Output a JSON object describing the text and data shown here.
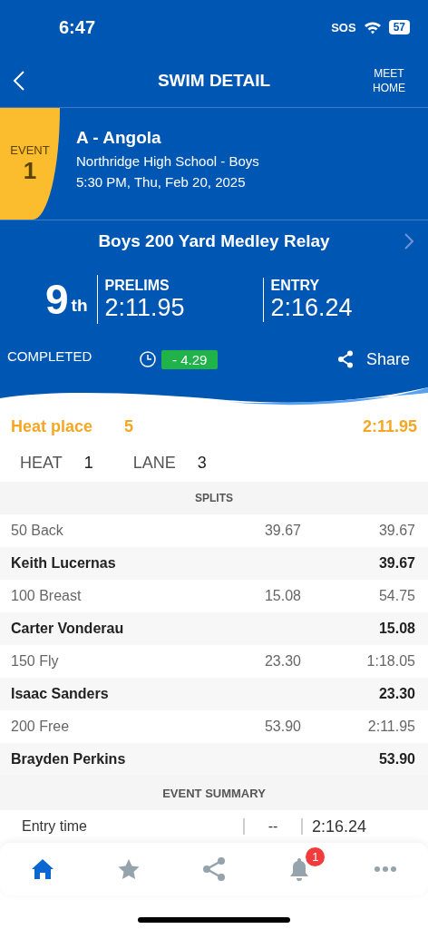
{
  "status_bar": {
    "time": "6:47",
    "sos": "SOS",
    "battery": "57"
  },
  "nav": {
    "title": "SWIM DETAIL",
    "right_button": "MEET HOME"
  },
  "event": {
    "label": "EVENT",
    "number": "1",
    "team": "A - Angola",
    "school": "Northridge High School - Boys",
    "datetime": "5:30 PM, Thu, Feb 20, 2025"
  },
  "relay_title": "Boys 200 Yard Medley Relay",
  "result": {
    "place": "9",
    "place_suffix": "th",
    "prelims_label": "PRELIMS",
    "prelims_time": "2:11.95",
    "entry_label": "ENTRY",
    "entry_time": "2:16.24"
  },
  "status": "COMPLETED",
  "time_diff": "- 4.29",
  "share": "Share",
  "heat_place": {
    "label": "Heat place",
    "value": "5",
    "time": "2:11.95"
  },
  "heat": {
    "heat_label": "HEAT",
    "heat": "1",
    "lane_label": "LANE",
    "lane": "3"
  },
  "splits_header": "SPLITS",
  "splits": [
    {
      "kind": "split",
      "label": "50 Back",
      "split": "39.67",
      "cumulative": "39.67"
    },
    {
      "kind": "swimmer",
      "label": "Keith Lucernas",
      "time": "39.67"
    },
    {
      "kind": "split",
      "label": "100 Breast",
      "split": "15.08",
      "cumulative": "54.75"
    },
    {
      "kind": "swimmer",
      "label": "Carter Vonderau",
      "time": "15.08"
    },
    {
      "kind": "split",
      "label": "150 Fly",
      "split": "23.30",
      "cumulative": "1:18.05"
    },
    {
      "kind": "swimmer",
      "label": "Isaac Sanders",
      "time": "23.30"
    },
    {
      "kind": "split",
      "label": "200 Free",
      "split": "53.90",
      "cumulative": "2:11.95"
    },
    {
      "kind": "swimmer",
      "label": "Brayden Perkins",
      "time": "53.90"
    }
  ],
  "summary_header": "EVENT SUMMARY",
  "summary": [
    {
      "label": "Entry time",
      "col_2": "--",
      "col_3": "2:16.24"
    }
  ],
  "tab_bar": [
    {
      "kind": "home",
      "selected": true
    },
    {
      "kind": "star",
      "selected": false
    },
    {
      "kind": "share",
      "selected": false
    },
    {
      "kind": "bell",
      "selected": false,
      "badge": "1"
    },
    {
      "kind": "more",
      "selected": false
    }
  ]
}
